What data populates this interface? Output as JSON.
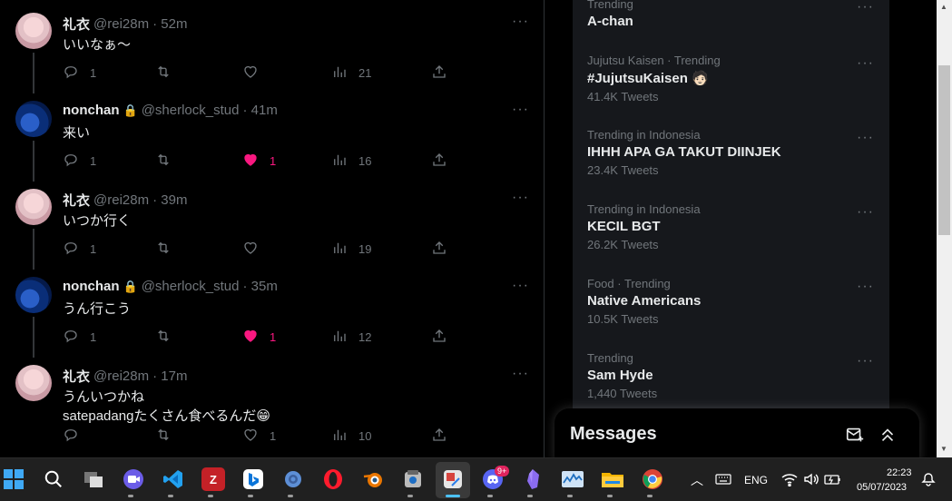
{
  "tweets": [
    {
      "avatar": "pink",
      "name": "礼衣",
      "locked": false,
      "handle": "@rei28m",
      "time": "· 52m",
      "text": "いいなぁ～",
      "text2": "",
      "replies": "1",
      "retweets": "",
      "likes": "",
      "liked": false,
      "views": "21"
    },
    {
      "avatar": "blue",
      "name": "nonchan",
      "locked": true,
      "handle": "@sherlock_stud",
      "time": "· 41m",
      "text": "来い",
      "text2": "",
      "replies": "1",
      "retweets": "",
      "likes": "1",
      "liked": true,
      "views": "16"
    },
    {
      "avatar": "pink",
      "name": "礼衣",
      "locked": false,
      "handle": "@rei28m",
      "time": "· 39m",
      "text": "いつか行く",
      "text2": "",
      "replies": "1",
      "retweets": "",
      "likes": "",
      "liked": false,
      "views": "19"
    },
    {
      "avatar": "blue",
      "name": "nonchan",
      "locked": true,
      "handle": "@sherlock_stud",
      "time": "· 35m",
      "text": "うん行こう",
      "text2": "",
      "replies": "1",
      "retweets": "",
      "likes": "1",
      "liked": true,
      "views": "12"
    },
    {
      "avatar": "pink",
      "name": "礼衣",
      "locked": false,
      "handle": "@rei28m",
      "time": "· 17m",
      "text": "うんいつかね",
      "text2": "satepadangたくさん食べるんだ😁",
      "replies": "",
      "retweets": "",
      "likes": "1",
      "liked": false,
      "views": "10"
    }
  ],
  "trends": [
    {
      "meta": "Trending",
      "title": "A-chan",
      "count": ""
    },
    {
      "meta": "Jujutsu Kaisen · Trending",
      "title": "#JujutsuKaisen 🧑🏻",
      "count": "41.4K Tweets"
    },
    {
      "meta": "Trending in Indonesia",
      "title": "IHHH APA GA TAKUT DIINJEK",
      "count": "23.4K Tweets"
    },
    {
      "meta": "Trending in Indonesia",
      "title": "KECIL BGT",
      "count": "26.2K Tweets"
    },
    {
      "meta": "Food · Trending",
      "title": "Native Americans",
      "count": "10.5K Tweets"
    },
    {
      "meta": "Trending",
      "title": "Sam Hyde",
      "count": "1,440 Tweets"
    }
  ],
  "messages": {
    "title": "Messages",
    "new_icon": "new-message-icon",
    "collapse_icon": "chevrons-up-icon"
  },
  "more_glyph": "···",
  "taskbar": {
    "apps": [
      "windows-start",
      "search",
      "task-view",
      "meet",
      "vscode",
      "zotero",
      "bing",
      "settings",
      "opera",
      "blender",
      "app-store",
      "snipping-tool",
      "discord",
      "obsidian",
      "task-manager",
      "file-explorer",
      "chrome"
    ],
    "discord_badge": "9+",
    "lang": "ENG",
    "time": "22:23",
    "date": "05/07/2023"
  }
}
